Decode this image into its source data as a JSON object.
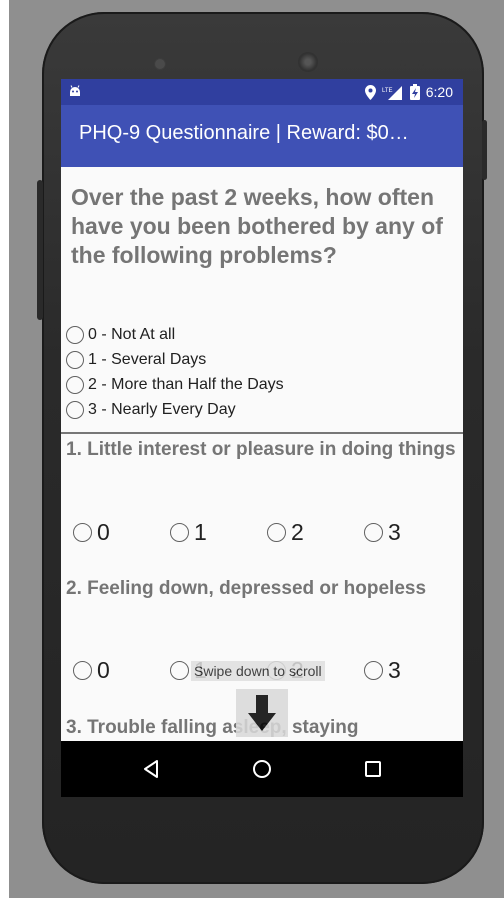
{
  "status_bar": {
    "time": "6:20",
    "icons": [
      "android-icon",
      "location-pin-icon",
      "lte-signal-icon",
      "battery-charging-icon"
    ]
  },
  "app_bar": {
    "title": "PHQ-9 Questionnaire | Reward: $0…"
  },
  "instruction": "Over the past 2 weeks, how often have you been bothered by any of the following problems?",
  "legend": [
    "0 - Not At all",
    "1 - Several Days",
    "2 - More than Half the Days",
    "3 - Nearly Every Day"
  ],
  "questions": [
    {
      "label": "1. Little interest or pleasure in doing things",
      "options": [
        "0",
        "1",
        "2",
        "3"
      ]
    },
    {
      "label": "2. Feeling down, depressed or hopeless",
      "options": [
        "0",
        "1",
        "2",
        "3"
      ]
    },
    {
      "label": "3. Trouble falling asleep, staying"
    }
  ],
  "scroll_hint": {
    "text": "Swipe down to scroll",
    "icon": "arrow-down-icon"
  },
  "nav_bar": {
    "icons": [
      "back-triangle-icon",
      "home-circle-icon",
      "recents-square-icon"
    ]
  },
  "colors": {
    "status_bar": "#303f9f",
    "app_bar": "#3f51b5",
    "header_text": "#757575",
    "emulator_background": "#8f8f8f"
  }
}
